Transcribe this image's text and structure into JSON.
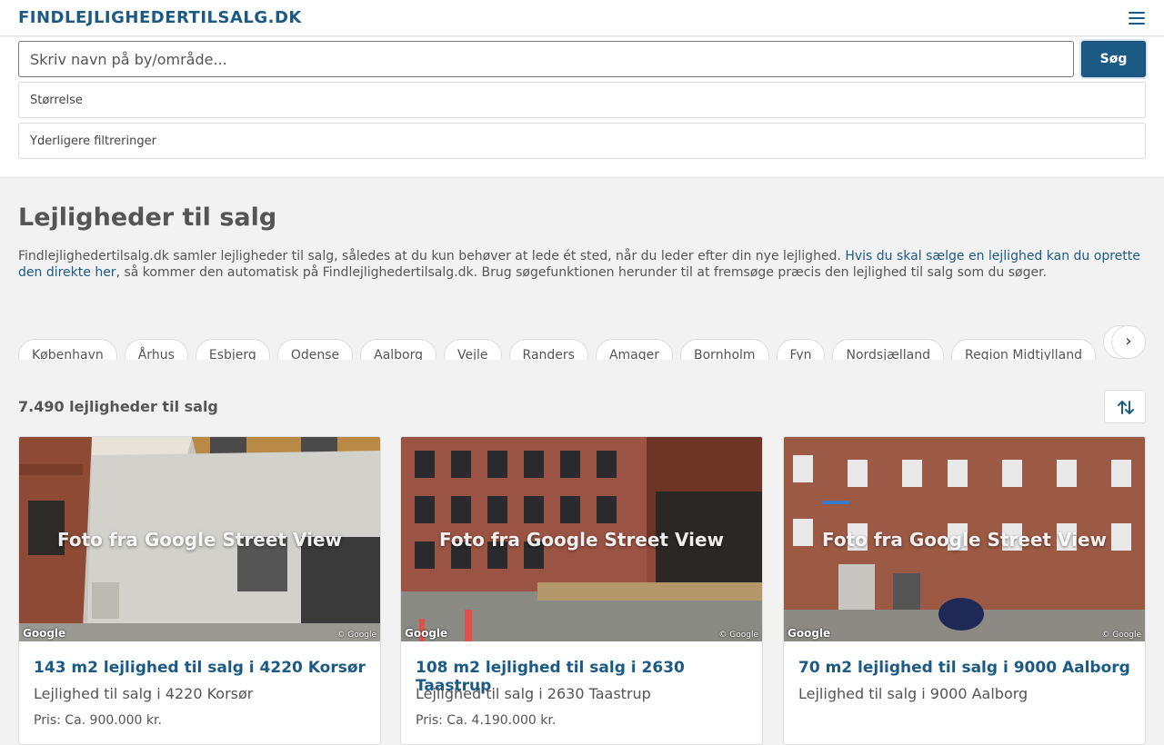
{
  "header": {
    "logo": "FINDLEJLIGHEDERTILSALG.DK"
  },
  "search": {
    "placeholder": "Skriv navn på by/område...",
    "button": "Søg"
  },
  "filters": [
    "Størrelse",
    "Yderligere filtreringer"
  ],
  "main": {
    "title": "Lejligheder til salg",
    "intro_part1": "Findlejlighedertilsalg.dk samler lejligheder til salg, således at du kun behøver at lede ét sted, når du leder efter din nye lejlighed. ",
    "intro_link": "Hvis du skal sælge en lejlighed kan du oprette den direkte her",
    "intro_part2": ", så kommer den automatisk på Findlejlighedertilsalg.dk. Brug søgefunktionen herunder til at fremsøge præcis den lejlighed til salg som du søger."
  },
  "chips": [
    "København",
    "Århus",
    "Esbjerg",
    "Odense",
    "Aalborg",
    "Vejle",
    "Randers",
    "Amager",
    "Bornholm",
    "Fyn",
    "Nordsjælland",
    "Region Midtjylland",
    ""
  ],
  "chip_next": "›",
  "results": {
    "count": "7.490 lejligheder til salg"
  },
  "photo_caption": "Foto fra Google Street View",
  "google_label": "Google",
  "google_copy": "© Google",
  "cards": [
    {
      "title": "143 m2 lejlighed til salg i 4220 Korsør",
      "subtitle": "Lejlighed til salg i 4220 Korsør",
      "price": "Pris: Ca. 900.000 kr."
    },
    {
      "title": "108 m2 lejlighed til salg i 2630 Taastrup",
      "subtitle": "Lejlighed til salg i 2630 Taastrup",
      "price": "Pris: Ca. 4.190.000 kr."
    },
    {
      "title": "70 m2 lejlighed til salg i 9000 Aalborg",
      "subtitle": "Lejlighed til salg i 9000 Aalborg",
      "price": ""
    }
  ],
  "colors": {
    "brand": "#1c5a86",
    "background": "#f2f2f2"
  },
  "icons": {
    "menu": "hamburger-menu-icon",
    "sort": "sort-arrows-icon"
  }
}
